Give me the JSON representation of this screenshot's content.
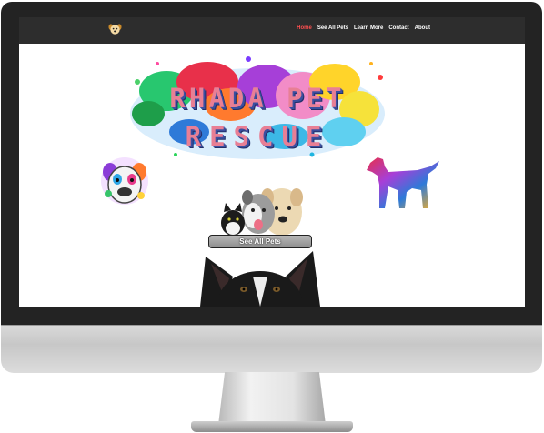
{
  "nav": {
    "links": [
      {
        "label": "Home",
        "active": true
      },
      {
        "label": "See All Pets",
        "active": false
      },
      {
        "label": "Learn More",
        "active": false
      },
      {
        "label": "Contact",
        "active": false
      },
      {
        "label": "About",
        "active": false
      }
    ]
  },
  "hero": {
    "title_line1": "RHADA PET",
    "title_line2": "RESCUE"
  },
  "cta": {
    "see_all_label": "See All Pets"
  },
  "icons": {
    "logo": "dog-face-icon"
  },
  "colors": {
    "navbar": "#2d2d2d",
    "active_link": "#ff4f4f",
    "title_fill": "#e87f95",
    "title_shadow": "#3a4fa0"
  }
}
